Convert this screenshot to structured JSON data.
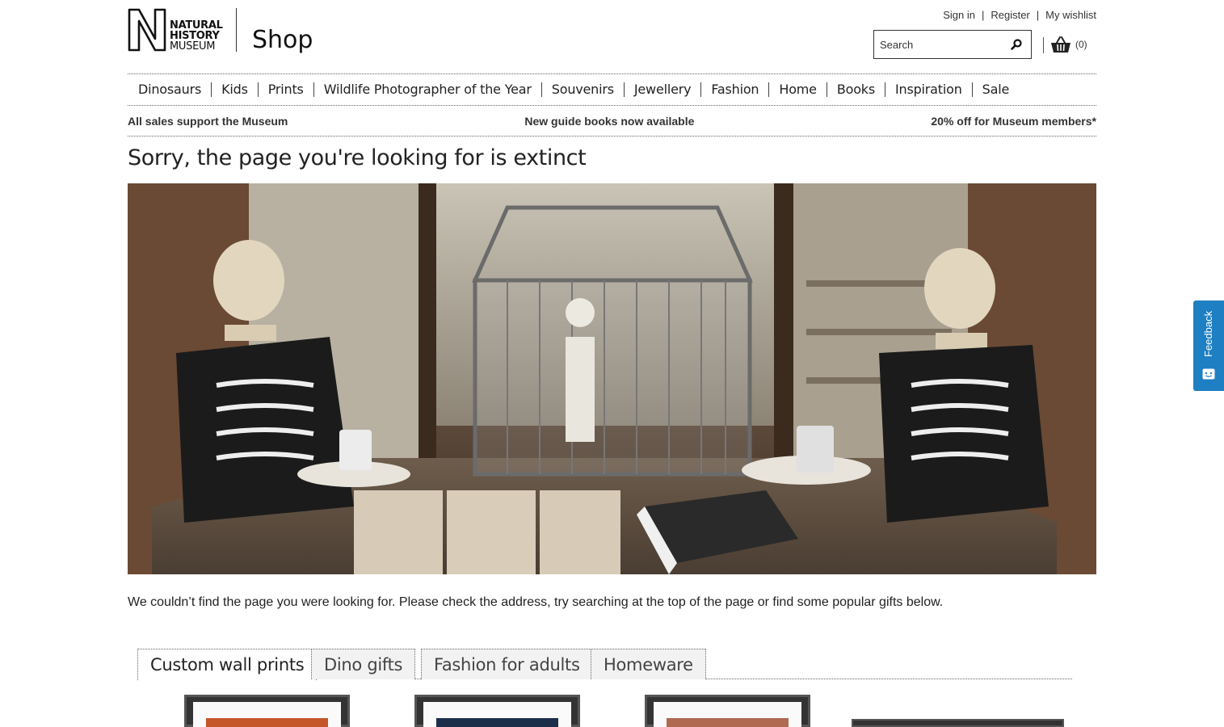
{
  "brand": {
    "logo_lines": [
      "NATURAL",
      "HISTORY",
      "MUSEUM"
    ],
    "shop_label": "Shop"
  },
  "top_links": {
    "sign_in": "Sign in",
    "register": "Register",
    "wishlist": "My wishlist"
  },
  "search": {
    "placeholder": "Search",
    "icon": "search-icon"
  },
  "basket": {
    "icon": "basket-icon",
    "count": "(0)"
  },
  "nav": {
    "items": [
      {
        "label": "Dinosaurs"
      },
      {
        "label": "Kids"
      },
      {
        "label": "Prints"
      },
      {
        "label": "Wildlife Photographer of the Year"
      },
      {
        "label": "Souvenirs"
      },
      {
        "label": "Jewellery"
      },
      {
        "label": "Fashion"
      },
      {
        "label": "Home"
      },
      {
        "label": "Books"
      },
      {
        "label": "Inspiration"
      },
      {
        "label": "Sale"
      }
    ]
  },
  "promo": {
    "left": "All sales support the Museum",
    "center": "New guide books now available",
    "right": "20% off for Museum members*"
  },
  "page": {
    "title": "Sorry, the page you're looking for is extinct",
    "message": "We couldn’t find the page you were looking for. Please check the address, try searching at the top of the page or find some popular gifts below."
  },
  "tabs": [
    {
      "label": "Custom wall prints",
      "active": true
    },
    {
      "label": "Dino gifts",
      "active": false
    },
    {
      "label": "Fashion for adults",
      "active": false
    },
    {
      "label": "Homeware",
      "active": false
    }
  ],
  "feedback": {
    "label": "Feedback",
    "color": "#1e7fc2"
  }
}
